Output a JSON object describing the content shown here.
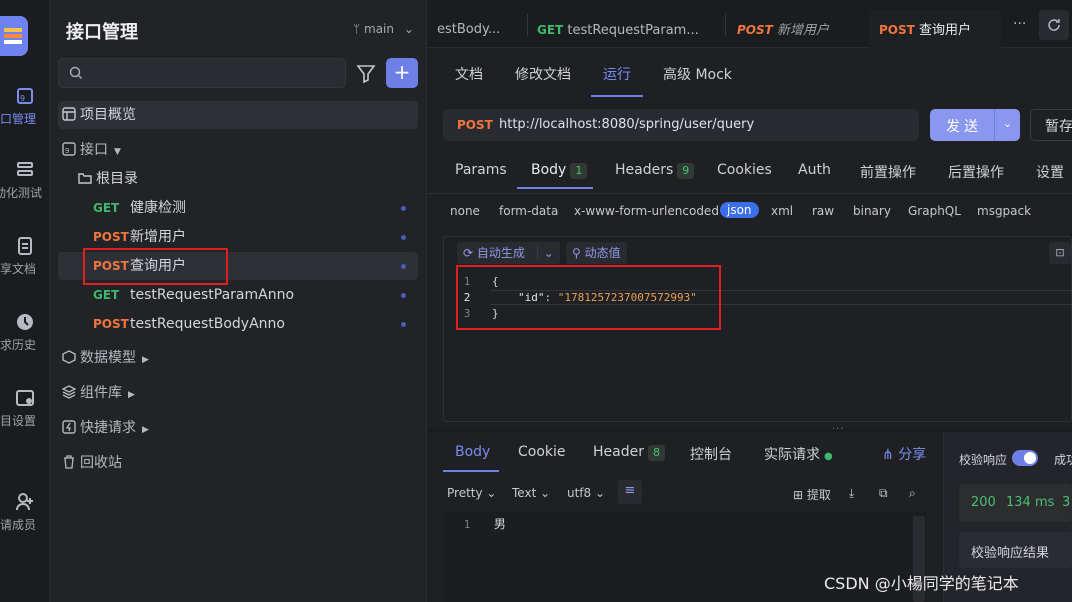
{
  "rail": [
    {
      "label": "口管理",
      "icon": "api-icon",
      "active": true
    },
    {
      "label": "动化测试",
      "icon": "automation-icon"
    },
    {
      "label": "享文档",
      "icon": "doc-share-icon"
    },
    {
      "label": "求历史",
      "icon": "history-icon"
    },
    {
      "label": "目设置",
      "icon": "settings-icon"
    },
    {
      "label": "请成员",
      "icon": "invite-member-icon"
    }
  ],
  "sidebar": {
    "title": "接口管理",
    "branch": "main",
    "search_placeholder": "",
    "add_label": "+",
    "overview": "项目概览",
    "api_folder": "接口",
    "root_dir": "根目录",
    "endpoints": [
      {
        "method": "GET",
        "name": "健康检测"
      },
      {
        "method": "POST",
        "name": "新增用户"
      },
      {
        "method": "POST",
        "name": "查询用户"
      },
      {
        "method": "GET",
        "name": "testRequestParamAnno"
      },
      {
        "method": "POST",
        "name": "testRequestBodyAnno"
      }
    ],
    "data_model": "数据模型",
    "components": "组件库",
    "quick_request": "快捷请求",
    "recycle_bin": "回收站"
  },
  "tabs": [
    {
      "method": "",
      "label": "estBody..."
    },
    {
      "method": "GET",
      "label": "testRequestParam..."
    },
    {
      "method": "POST",
      "label": "新增用户"
    },
    {
      "method": "POST",
      "label": "查询用户"
    }
  ],
  "tabbar": {
    "more": "···"
  },
  "subtabs": [
    "文档",
    "修改文档",
    "运行",
    "高级 Mock"
  ],
  "request": {
    "method": "POST",
    "url": "http://localhost:8080/spring/user/query",
    "send": "发送",
    "save": "暂存"
  },
  "param_tabs": [
    {
      "label": "Params"
    },
    {
      "label": "Body",
      "badge": "1"
    },
    {
      "label": "Headers",
      "badge": "9"
    },
    {
      "label": "Cookies"
    },
    {
      "label": "Auth"
    },
    {
      "label": "前置操作"
    },
    {
      "label": "后置操作"
    },
    {
      "label": "设置"
    }
  ],
  "body_types": [
    "none",
    "form-data",
    "x-www-form-urlencoded",
    "json",
    "xml",
    "raw",
    "binary",
    "GraphQL",
    "msgpack"
  ],
  "editor": {
    "auto_generate": "自动生成",
    "dynamic_value": "动态值",
    "lines": [
      {
        "n": "1",
        "text": "{"
      },
      {
        "n": "2",
        "key": "\"id\"",
        "sep": ": ",
        "value": "\"1781257237007572993\""
      },
      {
        "n": "3",
        "text": "}"
      }
    ]
  },
  "response_tabs": [
    {
      "label": "Body"
    },
    {
      "label": "Cookie"
    },
    {
      "label": "Header",
      "badge": "8"
    },
    {
      "label": "控制台"
    },
    {
      "label": "实际请求"
    }
  ],
  "share": "分享",
  "response_tools": {
    "format": "Pretty",
    "type": "Text",
    "encoding": "utf8",
    "extract": "提取"
  },
  "response_body": [
    {
      "n": "1",
      "text": "男"
    }
  ],
  "validate": {
    "label": "校验响应",
    "success": "成功",
    "status": "200",
    "time": "134 ms",
    "size": "3",
    "result": "校验响应结果"
  },
  "watermark": "CSDN @小楊同学的笔记本"
}
